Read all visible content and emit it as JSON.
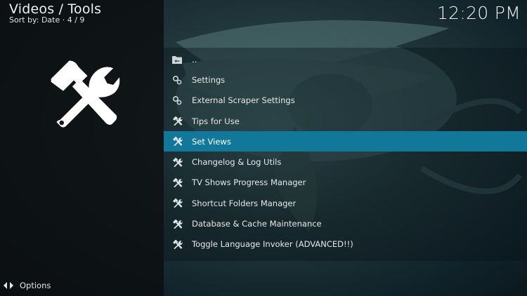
{
  "header": {
    "title": "Videos / Tools",
    "subtitle": "Sort by: Date  ·  4 / 9"
  },
  "clock": "12:20 PM",
  "side_icon": "tools-icon",
  "list": {
    "items": [
      {
        "label": "..",
        "icon": "folder-back-icon",
        "focused": false
      },
      {
        "label": "Settings",
        "icon": "gears-icon",
        "focused": false
      },
      {
        "label": "External Scraper Settings",
        "icon": "gears-icon",
        "focused": false
      },
      {
        "label": "Tips for Use",
        "icon": "tools-icon",
        "focused": false
      },
      {
        "label": "Set Views",
        "icon": "tools-icon",
        "focused": true
      },
      {
        "label": "Changelog & Log Utils",
        "icon": "tools-icon",
        "focused": false
      },
      {
        "label": "TV Shows Progress Manager",
        "icon": "tools-icon",
        "focused": false
      },
      {
        "label": "Shortcut Folders Manager",
        "icon": "tools-icon",
        "focused": false
      },
      {
        "label": "Database & Cache Maintenance",
        "icon": "tools-icon",
        "focused": false
      },
      {
        "label": "Toggle Language Invoker (ADVANCED!!)",
        "icon": "tools-icon",
        "focused": false
      }
    ]
  },
  "footer": {
    "options_label": "Options",
    "options_icon": "options-arrows-icon"
  },
  "colors": {
    "focus": "#12789a",
    "text": "#e8e8e8"
  }
}
